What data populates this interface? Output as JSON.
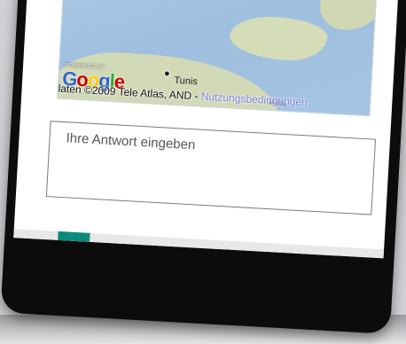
{
  "map": {
    "powered_by": "POWERED BY",
    "logo": "Google",
    "city": "Tunis",
    "city2": "Malta",
    "attribution": "laten ©2009 Tele Atlas, AND - ",
    "terms_link": "Nutzungsbedingungen"
  },
  "answer": {
    "placeholder": "Ihre Antwort eingeben",
    "value": ""
  },
  "colors": {
    "accent": "#0c8a7c",
    "link": "#7b7fe0"
  }
}
